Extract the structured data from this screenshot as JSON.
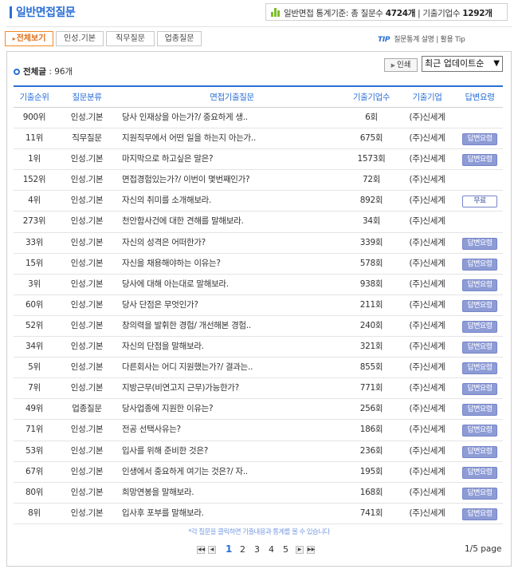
{
  "header": {
    "title": "일반면접질문",
    "stats_prefix": "일반면접 통계기준: 총 질문수 ",
    "total_questions": "4724개",
    "stats_mid": " | 기출기업수 ",
    "total_companies": "1292개"
  },
  "tabs": [
    {
      "label": "전체보기",
      "active": true
    },
    {
      "label": "인성.기본",
      "active": false
    },
    {
      "label": "직무질문",
      "active": false
    },
    {
      "label": "업종질문",
      "active": false
    }
  ],
  "tip": {
    "label": "TIP",
    "text": "질문통계 설명 | 활용 Tip"
  },
  "list": {
    "count_label": "전체글",
    "count_value": " : 96개",
    "print_label": "인쇄",
    "sort_selected": "최근 업데이트순"
  },
  "table": {
    "headers": {
      "rank": "기출순위",
      "category": "질문분류",
      "question": "면접기출질문",
      "count": "기출기업수",
      "company": "기출기업",
      "answer": "답변요령"
    },
    "rows": [
      {
        "rank": "900위",
        "category": "인성.기본",
        "question": "당사 인재상을 아는가?/ 중요하게 생..",
        "count": "6회",
        "company": "(주)신세계",
        "answer": ""
      },
      {
        "rank": "11위",
        "category": "직무질문",
        "question": "지원직무에서 어떤 일을 하는지 아는가..",
        "count": "675회",
        "company": "(주)신세계",
        "answer": "답변요령"
      },
      {
        "rank": "1위",
        "category": "인성.기본",
        "question": "마지막으로 하고싶은 말은?",
        "count": "1573회",
        "company": "(주)신세계",
        "answer": "답변요령"
      },
      {
        "rank": "152위",
        "category": "인성.기본",
        "question": "면접경험있는가?/ 이번이 몇번째인가?",
        "count": "72회",
        "company": "(주)신세계",
        "answer": ""
      },
      {
        "rank": "4위",
        "category": "인성.기본",
        "question": "자신의 취미를 소개해보라.",
        "count": "892회",
        "company": "(주)신세계",
        "answer": "무료"
      },
      {
        "rank": "273위",
        "category": "인성.기본",
        "question": "천안함사건에 대한 견해를 말해보라.",
        "count": "34회",
        "company": "(주)신세계",
        "answer": ""
      },
      {
        "rank": "33위",
        "category": "인성.기본",
        "question": "자신의 성격은 어떠한가?",
        "count": "339회",
        "company": "(주)신세계",
        "answer": "답변요령"
      },
      {
        "rank": "15위",
        "category": "인성.기본",
        "question": "자신을 채용해야하는 이유는?",
        "count": "578회",
        "company": "(주)신세계",
        "answer": "답변요령"
      },
      {
        "rank": "3위",
        "category": "인성.기본",
        "question": "당사에 대해 아는대로 말해보라.",
        "count": "938회",
        "company": "(주)신세계",
        "answer": "답변요령"
      },
      {
        "rank": "60위",
        "category": "인성.기본",
        "question": "당사 단점은 무엇인가?",
        "count": "211회",
        "company": "(주)신세계",
        "answer": "답변요령"
      },
      {
        "rank": "52위",
        "category": "인성.기본",
        "question": "창의력을 발휘한 경험/ 개선해본 경험..",
        "count": "240회",
        "company": "(주)신세계",
        "answer": "답변요령"
      },
      {
        "rank": "34위",
        "category": "인성.기본",
        "question": "자신의 단점을 말해보라.",
        "count": "321회",
        "company": "(주)신세계",
        "answer": "답변요령"
      },
      {
        "rank": "5위",
        "category": "인성.기본",
        "question": "다른회사는 어디 지원했는가?/ 결과는..",
        "count": "855회",
        "company": "(주)신세계",
        "answer": "답변요령"
      },
      {
        "rank": "7위",
        "category": "인성.기본",
        "question": "지방근무(비연고지 근무)가능한가?",
        "count": "771회",
        "company": "(주)신세계",
        "answer": "답변요령"
      },
      {
        "rank": "49위",
        "category": "업종질문",
        "question": "당사업종에 지원한 이유는?",
        "count": "256회",
        "company": "(주)신세계",
        "answer": "답변요령"
      },
      {
        "rank": "71위",
        "category": "인성.기본",
        "question": "전공 선택사유는?",
        "count": "186회",
        "company": "(주)신세계",
        "answer": "답변요령"
      },
      {
        "rank": "53위",
        "category": "인성.기본",
        "question": "입사를 위해 준비한 것은?",
        "count": "236회",
        "company": "(주)신세계",
        "answer": "답변요령"
      },
      {
        "rank": "67위",
        "category": "인성.기본",
        "question": "인생에서 중요하게 여기는 것은?/ 자..",
        "count": "195회",
        "company": "(주)신세계",
        "answer": "답변요령"
      },
      {
        "rank": "80위",
        "category": "인성.기본",
        "question": "희망연봉을 말해보라.",
        "count": "168회",
        "company": "(주)신세계",
        "answer": "답변요령"
      },
      {
        "rank": "8위",
        "category": "인성.기본",
        "question": "입사후 포부를 말해보라.",
        "count": "741회",
        "company": "(주)신세계",
        "answer": "답변요령"
      }
    ]
  },
  "note": "*각 질문을 클릭하면 기출내용과 통계를 볼 수 있습니다",
  "pagination": {
    "pages": [
      "1",
      "2",
      "3",
      "4",
      "5"
    ],
    "current": "1",
    "info": "1/5 page"
  },
  "colors": {
    "accent": "#2b6fd6",
    "tab_active": "#f08a24",
    "answer_button": "#8e9cd6",
    "stats_icon": "#7cbd28"
  }
}
